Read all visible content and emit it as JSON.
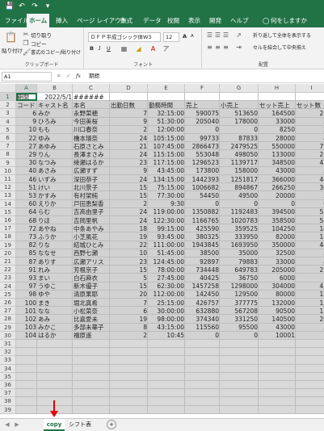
{
  "app": {
    "quick_access": [
      "save-icon",
      "undo-icon",
      "redo-icon",
      "customize-icon"
    ],
    "accent": "#217346",
    "selection_color": "#d2d2d2"
  },
  "ribbon_tabs": [
    {
      "label": "ファイル",
      "active": false
    },
    {
      "label": "ホーム",
      "active": true
    },
    {
      "label": "挿入",
      "active": false
    },
    {
      "label": "ページ レイアウト",
      "active": false
    },
    {
      "label": "数式",
      "active": false
    },
    {
      "label": "データ",
      "active": false
    },
    {
      "label": "校閲",
      "active": false
    },
    {
      "label": "表示",
      "active": false
    },
    {
      "label": "開発",
      "active": false
    },
    {
      "label": "ヘルプ",
      "active": false
    }
  ],
  "tell_me": "何をしますか",
  "ribbon": {
    "clipboard": {
      "paste": "貼り付け",
      "cut": "切り取り",
      "copy": "コピー",
      "format_painter": "書式のコピー/貼り付け",
      "group_name": "クリップボード"
    },
    "font": {
      "font_name": "ＤＦＰ平成ゴシック体W3",
      "font_size": "12",
      "grow": "A",
      "shrink": "A",
      "bold": "B",
      "italic": "I",
      "underline": "U",
      "group_name": "フォント"
    },
    "alignment": {
      "wrap_text": "折り返して全体を表示する",
      "merge_center": "セルを結合して中央揃え",
      "group_name": "配置"
    }
  },
  "formula_bar": {
    "name_box": "A1",
    "fx": "fx",
    "content": "期間"
  },
  "columns": [
    "A",
    "B",
    "C",
    "D",
    "E",
    "F",
    "G",
    "H",
    "I"
  ],
  "rows": [
    [
      "期間",
      "2022/5/1",
      "######",
      "",
      "",
      "",
      "",
      "",
      ""
    ],
    [
      "コード",
      "キャスト名",
      "本名",
      "出勤日数",
      "勤務時間",
      "売上",
      "小売上",
      "セット売上",
      "セット数"
    ],
    [
      "6",
      "みか",
      "永野菜穂",
      "7",
      "32:15:00",
      "590075",
      "513650",
      "164500",
      "21"
    ],
    [
      "9",
      "ひろみ",
      "今田美桜",
      "9",
      "51:30:00",
      "205040",
      "178000",
      "33000",
      "5"
    ],
    [
      "10",
      "もも",
      "川口春奈",
      "2",
      "12:00:00",
      "0",
      "0",
      "8250",
      "2"
    ],
    [
      "22",
      "ゆみ",
      "橋本環奈",
      "24",
      "105:15:00",
      "99733",
      "87833",
      "28000",
      "4"
    ],
    [
      "27",
      "あゆみ",
      "石原さとみ",
      "21",
      "107:45:00",
      "2866473",
      "2479525",
      "550000",
      "79"
    ],
    [
      "29",
      "りん",
      "長澤まさみ",
      "24",
      "115:15:00",
      "553048",
      "498050",
      "133000",
      "21"
    ],
    [
      "30",
      "なつみ",
      "綾瀬はるか",
      "23",
      "117:15:00",
      "1296523",
      "1139717",
      "348500",
      "45"
    ],
    [
      "40",
      "あさみ",
      "広瀬すず",
      "9",
      "43:45:00",
      "173800",
      "158000",
      "43000",
      "5"
    ],
    [
      "46",
      "いずみ",
      "深田恭子",
      "24",
      "134:15:00",
      "1442393",
      "1251817",
      "366000",
      "46"
    ],
    [
      "51",
      "けい",
      "北川景子",
      "15",
      "75:15:00",
      "1006682",
      "894867",
      "266250",
      "36"
    ],
    [
      "53",
      "かすみ",
      "有村架純",
      "15",
      "77:30:00",
      "54450",
      "49500",
      "20000",
      "3"
    ],
    [
      "60",
      "えりか",
      "戸田恵梨香",
      "2",
      "9:30",
      "0",
      "0",
      "0",
      "0"
    ],
    [
      "64",
      "らむ",
      "吉高由里子",
      "24",
      "119:00:00",
      "1350882",
      "1192483",
      "394500",
      "55"
    ],
    [
      "68",
      "りほ",
      "吉岡里帆",
      "24",
      "122:30:00",
      "1166765",
      "1020783",
      "358500",
      "54"
    ],
    [
      "72",
      "あやね",
      "中条あやみ",
      "18",
      "99:15:00",
      "425590",
      "359525",
      "104250",
      "14"
    ],
    [
      "73",
      "ふうか",
      "小芝風花",
      "19",
      "93:45:00",
      "380325",
      "333950",
      "82000",
      "11"
    ],
    [
      "82",
      "りな",
      "結城ひとみ",
      "22",
      "111:00:00",
      "1943845",
      "1693950",
      "350000",
      "48"
    ],
    [
      "85",
      "ななせ",
      "西野七瀬",
      "10",
      "51:45:00",
      "38500",
      "35000",
      "32500",
      "5"
    ],
    [
      "87",
      "ありす",
      "広瀬アリス",
      "23",
      "124:45:00",
      "92897",
      "79883",
      "33000",
      "4"
    ],
    [
      "91",
      "れみ",
      "芳根京子",
      "15",
      "78:00:00",
      "734448",
      "649783",
      "205000",
      "25"
    ],
    [
      "93",
      "まい",
      "白石麻衣",
      "5",
      "27:45:00",
      "40425",
      "36750",
      "6000",
      "1"
    ],
    [
      "97",
      "うゆこ",
      "新木優子",
      "15",
      "62:30:00",
      "1457258",
      "1298000",
      "304000",
      "45"
    ],
    [
      "98",
      "ゆや",
      "清原果耶",
      "20",
      "112:00:00",
      "142450",
      "129500",
      "80000",
      "13"
    ],
    [
      "100",
      "まき",
      "堀北真希",
      "7",
      "25:15:00",
      "426757",
      "377775",
      "132000",
      "15"
    ],
    [
      "101",
      "なな",
      "小松菜奈",
      "6",
      "30:00:00",
      "632880",
      "567208",
      "90500",
      "13"
    ],
    [
      "102",
      "あみ",
      "比嘉愛未",
      "19",
      "98:00:00",
      "374340",
      "331250",
      "140500",
      "20"
    ],
    [
      "103",
      "みかこ",
      "多部未華子",
      "8",
      "43:15:00",
      "115560",
      "95500",
      "43000",
      "5"
    ],
    [
      "104",
      "はるか",
      "福原遥",
      "2",
      "10:45",
      "0",
      "0",
      "10001",
      "1"
    ]
  ],
  "row_count": 39,
  "sheet_tabs": [
    {
      "label": "copy",
      "active": true
    },
    {
      "label": "シフト表",
      "active": false
    }
  ],
  "add_sheet": "+"
}
